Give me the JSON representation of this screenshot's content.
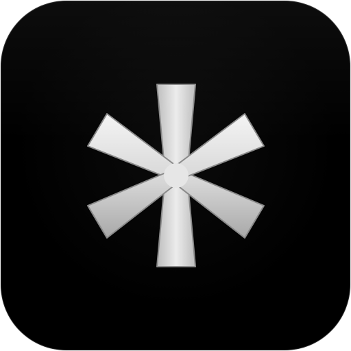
{
  "icon": {
    "name": "asterisk-icon",
    "background_color": "#000000",
    "glyph_color_light": "#f2f2f2",
    "glyph_color_dark": "#a9a9a9",
    "glyph_outline_color": "#7a7a7a"
  }
}
